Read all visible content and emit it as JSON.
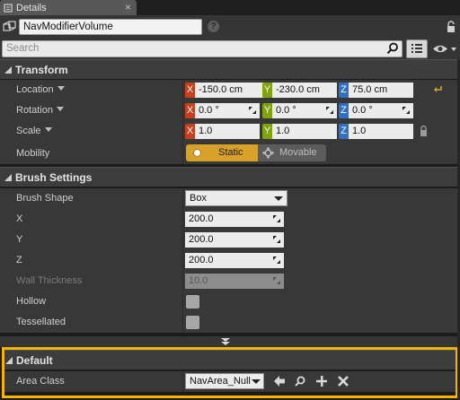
{
  "tab": {
    "title": "Details",
    "close_glyph": "×"
  },
  "header": {
    "actor_name": "NavModifierVolume",
    "help_glyph": "?"
  },
  "search": {
    "placeholder": "Search"
  },
  "sections": {
    "transform": "Transform",
    "brush": "Brush Settings",
    "default": "Default"
  },
  "transform": {
    "location": {
      "label": "Location",
      "x": "-150.0 cm",
      "y": "-230.0 cm",
      "z": "75.0 cm"
    },
    "rotation": {
      "label": "Rotation",
      "x": "0.0 °",
      "y": "0.0 °",
      "z": "0.0 °"
    },
    "scale": {
      "label": "Scale",
      "x": "1.0",
      "y": "1.0",
      "z": "1.0"
    },
    "mobility": {
      "label": "Mobility",
      "static": "Static",
      "movable": "Movable",
      "selected": "Static"
    },
    "axis_labels": {
      "x": "X",
      "y": "Y",
      "z": "Z"
    }
  },
  "brush": {
    "shape": {
      "label": "Brush Shape",
      "value": "Box"
    },
    "x": {
      "label": "X",
      "value": "200.0"
    },
    "y": {
      "label": "Y",
      "value": "200.0"
    },
    "z": {
      "label": "Z",
      "value": "200.0"
    },
    "wall_thickness": {
      "label": "Wall Thickness",
      "value": "10.0"
    },
    "hollow": {
      "label": "Hollow",
      "checked": false
    },
    "tessellated": {
      "label": "Tessellated",
      "checked": false
    }
  },
  "default": {
    "area_class": {
      "label": "Area Class",
      "value": "NavArea_Null"
    }
  },
  "colors": {
    "axis_x": "#c83f1e",
    "axis_y": "#7fa40f",
    "axis_z": "#2f6fc7",
    "mobility_active": "#d8a229",
    "highlight_border": "#f5b400"
  },
  "icons": [
    "tab-details-icon",
    "close-icon",
    "actor-icon",
    "help-icon",
    "lock-icon",
    "search-icon",
    "grid-view-icon",
    "eye-icon",
    "chevron-down-icon",
    "spin-arrow-icon",
    "reset-arrow-icon",
    "movable-icon",
    "expand-arrow-icon",
    "use-selected-arrow-icon",
    "browse-icon",
    "add-icon",
    "clear-icon"
  ]
}
